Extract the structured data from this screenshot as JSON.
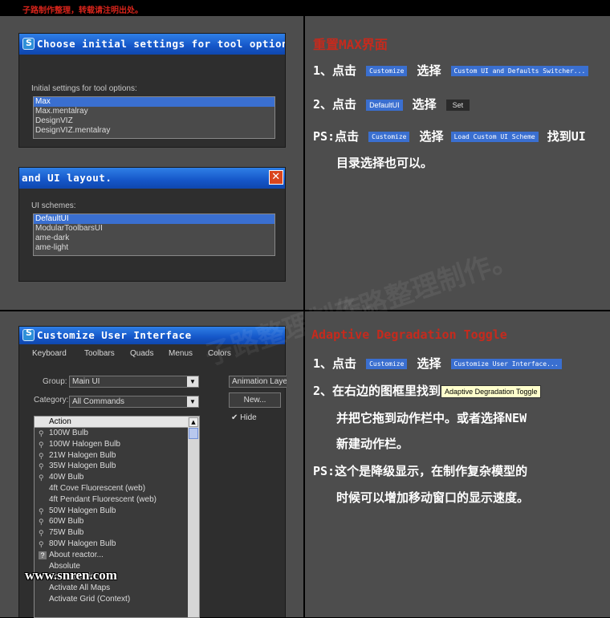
{
  "top_notice": "子路制作整理，转载请注明出处。",
  "dialog1": {
    "title": "Choose initial settings for tool options",
    "label": "Initial settings for tool options:",
    "options": [
      "Max",
      "Max.mentalray",
      "DesignVIZ",
      "DesignVIZ.mentalray"
    ],
    "selected_index": 0
  },
  "dialog2": {
    "title": "and UI layout.",
    "close_label": "✕",
    "label": "UI schemes:",
    "options": [
      "DefaultUI",
      "ModularToolbarsUI",
      "ame-dark",
      "ame-light"
    ],
    "selected_index": 0
  },
  "section1": {
    "heading": "重置MAX界面",
    "step1": {
      "prefix": "1、点击",
      "tag1": "Customize",
      "mid": "选择",
      "tag2": "Custom UI and Defaults Switcher..."
    },
    "step2": {
      "prefix": "2、点击",
      "tag1": "DefaultUI",
      "mid": "选择",
      "tag2": "Set"
    },
    "ps": {
      "prefix": "PS:点击",
      "tag1": "Customize",
      "mid": "选择",
      "tag2": "Load Custom UI Scheme",
      "suffix": "找到UI",
      "line2": "目录选择也可以。"
    }
  },
  "watermark": "子路整理制作。",
  "customize_dialog": {
    "title": "Customize User Interface",
    "tabs": [
      "Keyboard",
      "Toolbars",
      "Quads",
      "Menus",
      "Colors"
    ],
    "group_label": "Group:",
    "group_value": "Main UI",
    "category_label": "Category:",
    "category_value": "All Commands",
    "right_combo": "Animation Layers",
    "new_button": "New...",
    "hide_label": "Hide",
    "hide_checked": true,
    "list_header": "Action",
    "actions": [
      {
        "label": "100W Bulb",
        "icon": "lamp"
      },
      {
        "label": "100W Halogen Bulb",
        "icon": "lamp"
      },
      {
        "label": "21W Halogen Bulb",
        "icon": "lamp"
      },
      {
        "label": "35W Halogen Bulb",
        "icon": "lamp"
      },
      {
        "label": "40W Bulb",
        "icon": "lamp"
      },
      {
        "label": "4ft Cove Fluorescent (web)",
        "icon": ""
      },
      {
        "label": "4ft Pendant Fluorescent (web)",
        "icon": ""
      },
      {
        "label": "50W Halogen Bulb",
        "icon": "lamp"
      },
      {
        "label": "60W Bulb",
        "icon": "lamp"
      },
      {
        "label": "75W Bulb",
        "icon": "lamp"
      },
      {
        "label": "80W Halogen Bulb",
        "icon": "lamp"
      },
      {
        "label": "About reactor...",
        "icon": "help"
      },
      {
        "label": "Absolute",
        "icon": ""
      },
      {
        "label": "Activate Grid",
        "icon": ""
      },
      {
        "label": "Activate All Maps",
        "icon": ""
      },
      {
        "label": "Activate Grid (Context)",
        "icon": ""
      }
    ]
  },
  "site_watermark": "www.snren.com",
  "section2": {
    "heading": "Adaptive Degradation Toggle",
    "step1": {
      "prefix": "1、点击",
      "tag1": "Customize",
      "mid": "选择",
      "tag2": "Customize User Interface..."
    },
    "step2": {
      "prefix": "2、在右边的图框里找到",
      "tag": "Adaptive Degradation Toggle",
      "line2": "并把它拖到动作栏中。或者选择NEW",
      "line3": "新建动作栏。"
    },
    "ps": {
      "line1": "PS:这个是降级显示，在制作复杂模型的",
      "line2": "时候可以增加移动窗口的显示速度。"
    }
  }
}
